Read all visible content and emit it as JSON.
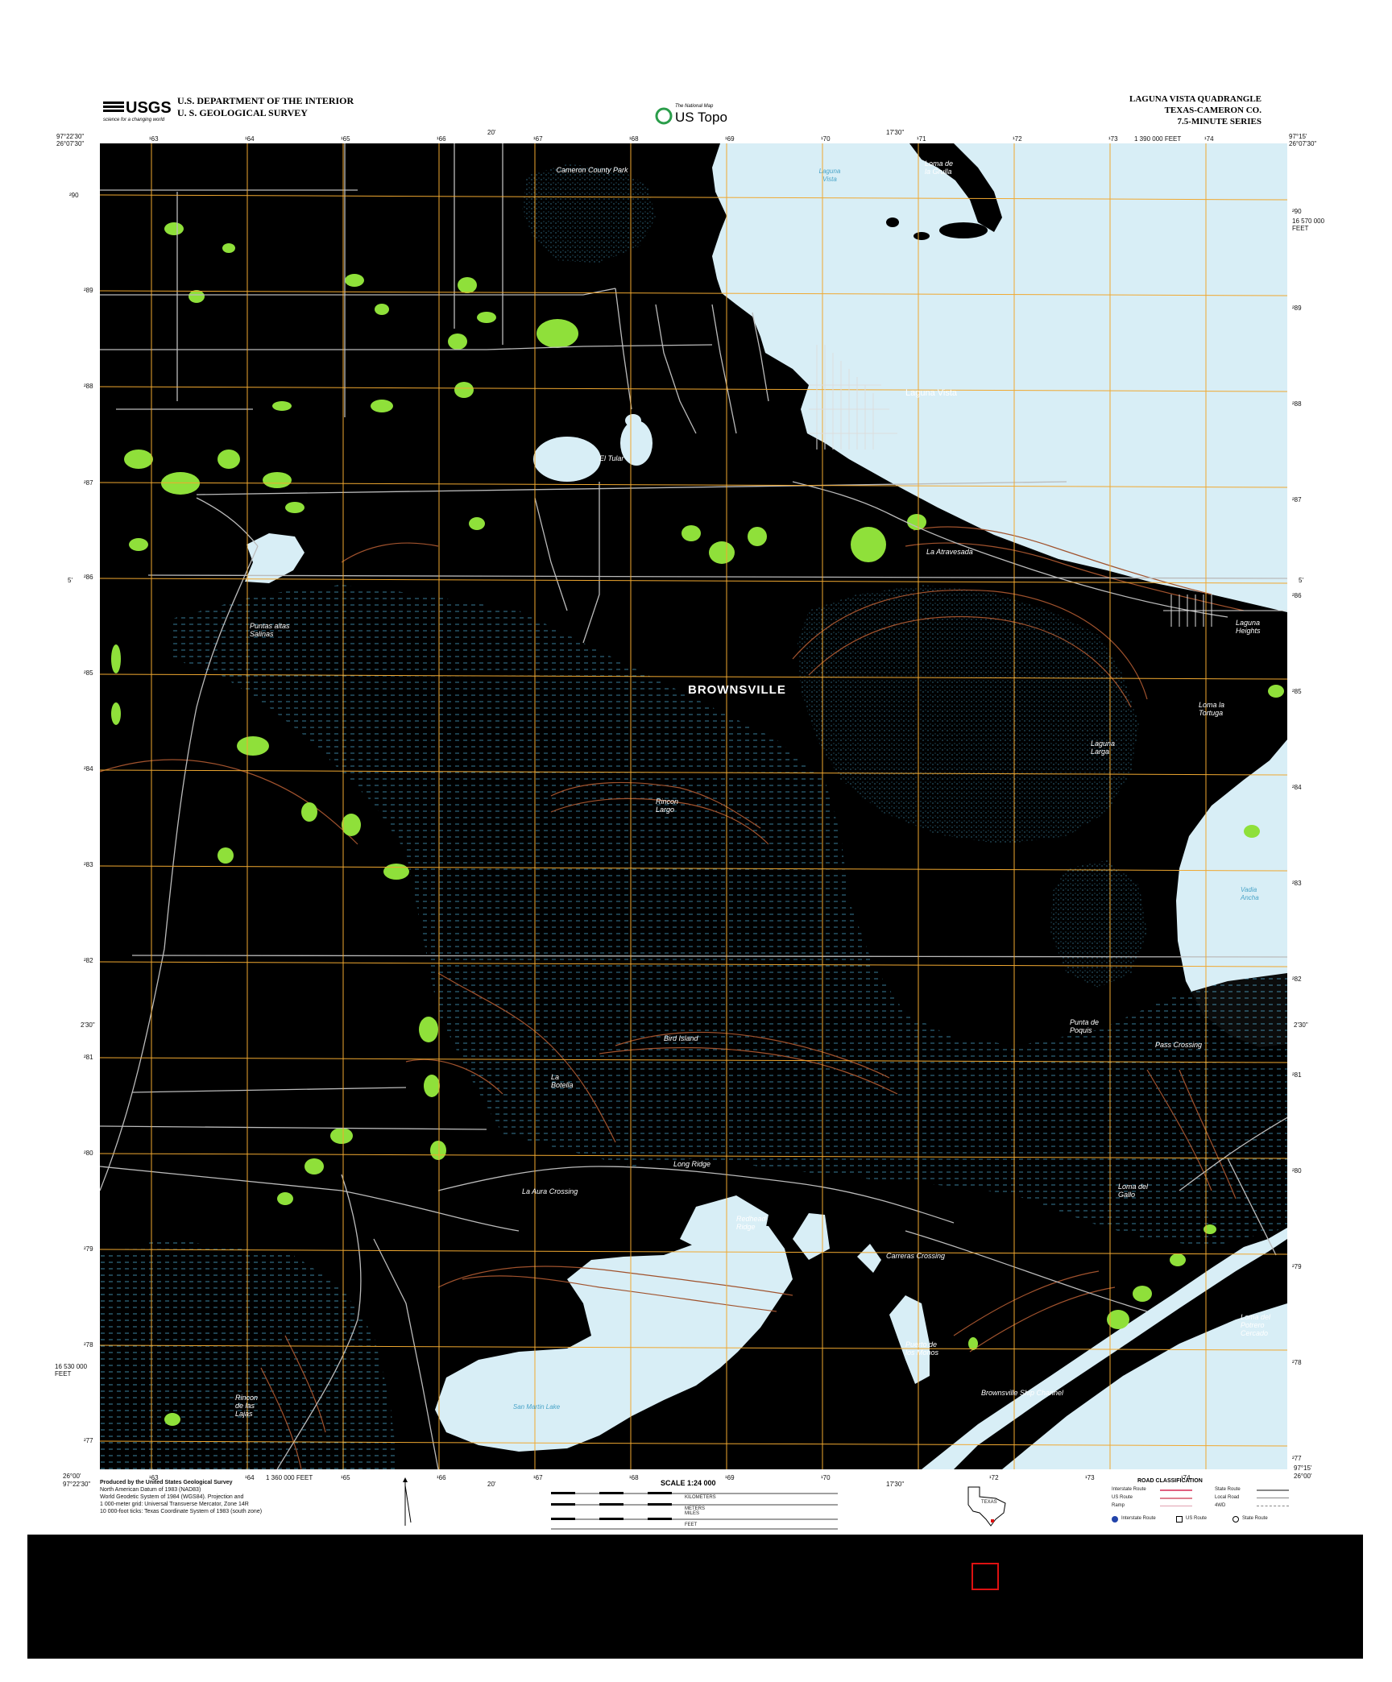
{
  "header": {
    "agency_line1": "U.S. DEPARTMENT OF THE INTERIOR",
    "agency_line2": "U. S. GEOLOGICAL SURVEY",
    "usgs_logo_text": "USGS",
    "usgs_tagline": "science for a changing world",
    "ustopo_small": "The National Map",
    "ustopo_text": "US Topo",
    "quad_title": "LAGUNA VISTA QUADRANGLE",
    "quad_state": "TEXAS-CAMERON CO.",
    "quad_series": "7.5-MINUTE SERIES"
  },
  "ticks": {
    "top": [
      "97°22'30\"",
      "¹63",
      "¹64",
      "¹65",
      "¹66",
      "20'",
      "¹67",
      "¹68",
      "¹69",
      "¹70",
      "17'30\"",
      "¹71",
      "¹72",
      "¹73",
      "1 390 000 FEET",
      "¹74",
      "97°15'"
    ],
    "bottom": [
      "97°22'30\"",
      "¹63",
      "¹64",
      "1 360 000 FEET",
      "¹65",
      "¹66",
      "20'",
      "¹67",
      "¹68",
      "¹69",
      "¹70",
      "17'30\"",
      "¹72",
      "¹73",
      "¹74",
      "97°15'"
    ],
    "corner_tl": "26°07'30\"",
    "corner_tr": "26°07'30\"",
    "corner_bl": "26°00'",
    "corner_br": "26°00'",
    "left": [
      "²90",
      "²89",
      "²88",
      "²87",
      "5'",
      "²86",
      "²85",
      "²84",
      "²83",
      "²82",
      "2'30\"",
      "²81",
      "²80",
      "²79",
      "²78",
      "16 530 000 FEET",
      "²77"
    ],
    "right": [
      "²90",
      "16 570 000 FEET",
      "²89",
      "²88",
      "²87",
      "5'",
      "²86",
      "²85",
      "²84",
      "²83",
      "²82",
      "2'30\"",
      "²81",
      "²80",
      "²79",
      "²78",
      "²77"
    ]
  },
  "places": {
    "city_big": "BROWNSVILLE",
    "laguna_vista": "Laguna Vista",
    "laguna_heights": "Laguna Heights",
    "loma_la_grulla": "Loma de la Grulla",
    "el_tular": "El Tular",
    "la_atravesada": "La Atravesada",
    "puntas_altas": "Puntas altas Salinas",
    "laguna_larga": "Laguna Larga",
    "loma_la_tortuga": "Loma la Tortuga",
    "rincon_largo": "Rincon Largo",
    "bird_island": "Bird Island",
    "la_botella": "La Botella",
    "long_ridge": "Long Ridge",
    "la_aura_crossing": "La Aura Crossing",
    "redhead_ridge": "Redhead Ridge",
    "carreras_crossing": "Carreras Crossing",
    "loma_del_gallo": "Loma del Gallo",
    "puerto_de_los_monos": "Puerto de los Monos",
    "brownsville_ship_channel": "Brownsville Ship Channel",
    "rincon_de_las_lajas": "Rincon de las Lajas",
    "loma_del_potrero": "Loma del Potrero Cercado",
    "punta_de_poquis": "Punta de Poquis",
    "pass_crossing": "Pass Crossing",
    "cameron_county_park": "Cameron County Park"
  },
  "water_labels": {
    "laguna_vista_water": "Laguna Vista",
    "vadia_ancha": "Vadia Ancha",
    "san_martin_lake": "San Martin Lake"
  },
  "footer": {
    "credits": [
      "Produced by the United States Geological Survey",
      "North American Datum of 1983 (NAD83)",
      "World Geodetic System of 1984 (WGS84). Projection and",
      "1 000-meter grid: Universal Transverse Mercator, Zone 14R",
      "10 000-foot ticks: Texas Coordinate System of 1983 (south zone)"
    ],
    "scale_title": "SCALE 1:24 000",
    "scale_units": [
      "KILOMETERS",
      "METERS",
      "MILES",
      "FEET"
    ],
    "texas_label": "TEXAS",
    "road_title": "ROAD CLASSIFICATION",
    "road_items": [
      "Interstate Route",
      "State Route",
      "US Route",
      "Local Road",
      "Ramp",
      "4WD",
      "Interstate Route",
      "US Route",
      "State Route"
    ]
  },
  "colors": {
    "map_bg": "#000000",
    "water": "#d8eef6",
    "grid": "#f0a830",
    "contour": "#a0522d",
    "vegetation": "#8fe03a",
    "marsh": "#4aa4c8",
    "road": "#bbbbbb"
  }
}
